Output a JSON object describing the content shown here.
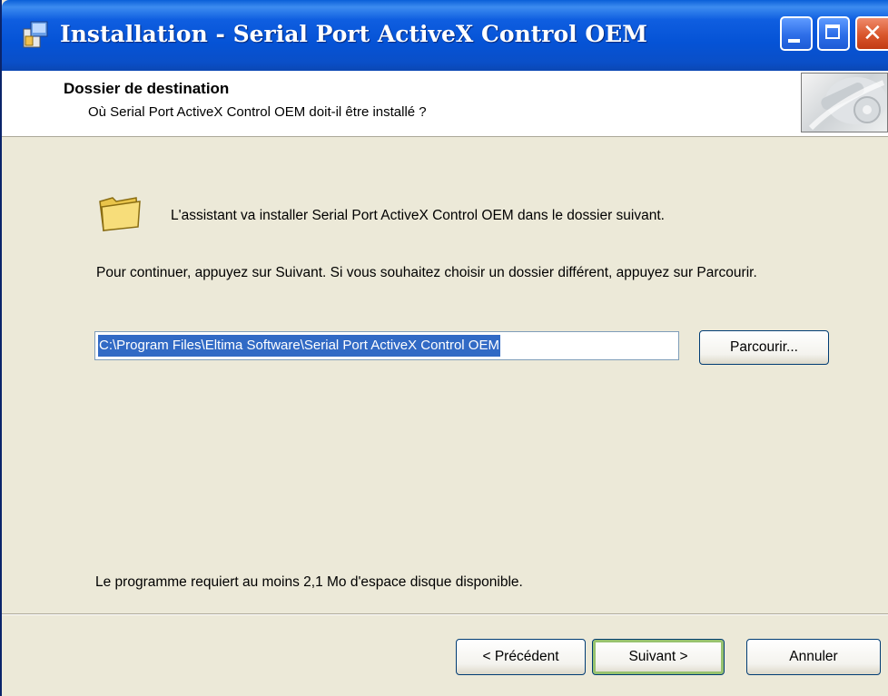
{
  "window": {
    "title": "Installation - Serial Port ActiveX Control OEM",
    "close_glyph": "✕"
  },
  "header": {
    "title": "Dossier de destination",
    "subtitle": "Où Serial Port ActiveX Control OEM doit-il être installé ?"
  },
  "body": {
    "intro": "L'assistant va installer Serial Port ActiveX Control OEM dans le dossier suivant.",
    "instructions": "Pour continuer, appuyez sur Suivant. Si vous souhaitez choisir un dossier différent, appuyez sur Parcourir.",
    "path_value": "C:\\Program Files\\Eltima Software\\Serial Port ActiveX Control OEM",
    "browse_label": "Parcourir...",
    "requirement": "Le programme requiert au moins 2,1 Mo d'espace disque disponible."
  },
  "footer": {
    "back_label": "< Précédent",
    "next_label": "Suivant >",
    "cancel_label": "Annuler"
  },
  "icons": {
    "app": "installer-icon",
    "folder": "folder-icon",
    "header_image": "wizard-header-image"
  },
  "colors": {
    "titlebar": "#0553d6",
    "dialog_bg": "#ece9d8",
    "selection": "#316ac5",
    "close_button": "#d9562c",
    "default_button_focus": "#97c26e"
  }
}
